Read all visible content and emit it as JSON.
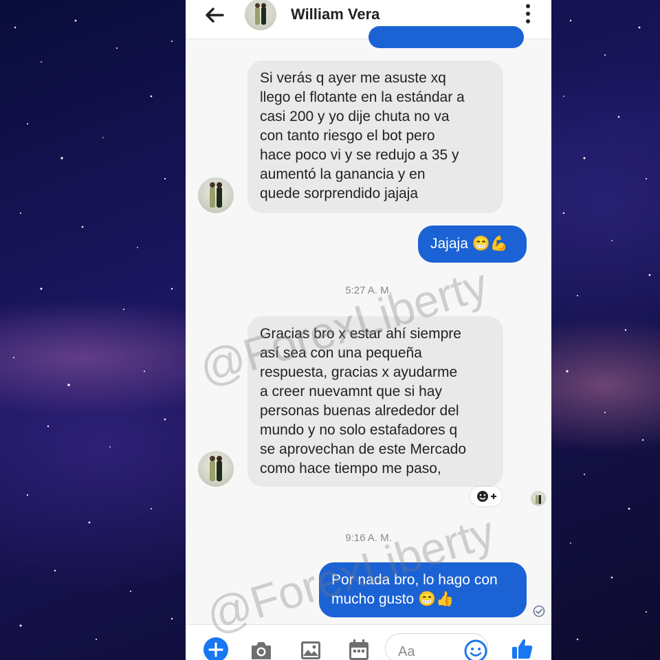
{
  "header": {
    "contact_name": "William Vera",
    "back_icon": "arrow-left-icon",
    "more_icon": "more-vertical-icon"
  },
  "messages": [
    {
      "direction": "incoming",
      "lines": [
        "Si verás q ayer me asuste xq",
        "llego el flotante en la estándar a",
        "casi 200 y yo dije chuta no va",
        "con tanto riesgo el bot pero",
        "hace poco vi y se redujo a 35 y",
        "aumentó la ganancia y en",
        "quede sorprendido jajaja"
      ]
    },
    {
      "direction": "outgoing",
      "text": "Jajaja 😁💪"
    },
    {
      "direction": "timestamp",
      "text": "5:27 A. M."
    },
    {
      "direction": "incoming",
      "lines": [
        "Gracias bro x estar ahí siempre",
        "así sea con una pequeña",
        "respuesta, gracias x ayudarme",
        "a creer nuevamnt que si hay",
        "personas buenas alrededor del",
        "mundo y no solo estafadores q",
        "se aprovechan de este Mercado",
        "como hace tiempo me paso,"
      ]
    },
    {
      "direction": "timestamp",
      "text": "9:16 A. M."
    },
    {
      "direction": "outgoing",
      "lines": [
        "Por nada bro, lo hago con",
        "mucho gusto 😁👍"
      ]
    }
  ],
  "composer": {
    "placeholder": "Aa",
    "icons": [
      "plus-icon",
      "camera-icon",
      "gallery-icon",
      "calendar-icon",
      "emoji-icon",
      "thumbs-up-icon"
    ]
  },
  "watermark": {
    "text": "@ForexLiberty"
  },
  "colors": {
    "outgoing_bubble": "#1b62d4",
    "incoming_bubble": "#e9e9ea",
    "accent": "#1877f2"
  }
}
